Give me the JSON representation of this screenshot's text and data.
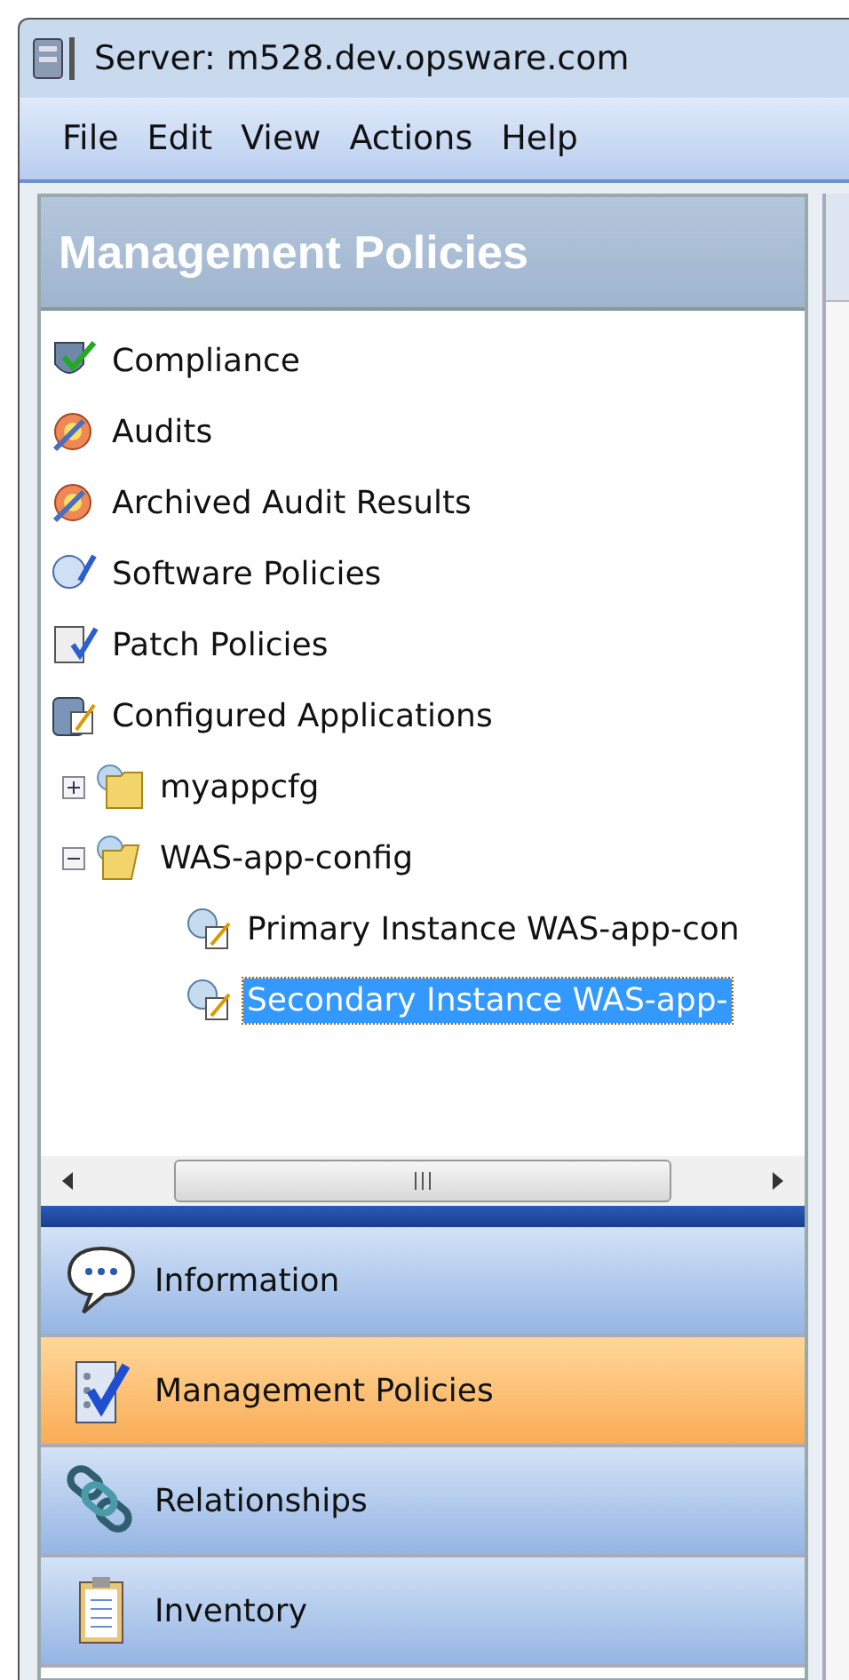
{
  "window": {
    "title": "Server: m528.dev.opsware.com"
  },
  "menu": [
    "File",
    "Edit",
    "View",
    "Actions",
    "Help"
  ],
  "panel": {
    "title": "Management Policies"
  },
  "tree": [
    {
      "label": "Compliance",
      "kind": "compliance",
      "selected": false
    },
    {
      "label": "Audits",
      "kind": "audit",
      "selected": false
    },
    {
      "label": "Archived Audit Results",
      "kind": "audit",
      "selected": false
    },
    {
      "label": "Software Policies",
      "kind": "software",
      "selected": false
    },
    {
      "label": "Patch Policies",
      "kind": "patch",
      "selected": false
    },
    {
      "label": "Configured Applications",
      "kind": "configured",
      "selected": false,
      "children": [
        {
          "label": "myappcfg",
          "selected": false,
          "expanded": false
        },
        {
          "label": "WAS-app-config",
          "selected": false,
          "expanded": true,
          "children": [
            {
              "label": "Primary Instance WAS-app-con",
              "selected": false
            },
            {
              "label": "Secondary Instance WAS-app-",
              "selected": true
            }
          ]
        }
      ]
    }
  ],
  "nav": [
    {
      "label": "Information",
      "kind": "info",
      "selected": false
    },
    {
      "label": "Management Policies",
      "kind": "policies",
      "selected": true
    },
    {
      "label": "Relationships",
      "kind": "relationships",
      "selected": false
    },
    {
      "label": "Inventory",
      "kind": "inventory",
      "selected": false
    }
  ]
}
